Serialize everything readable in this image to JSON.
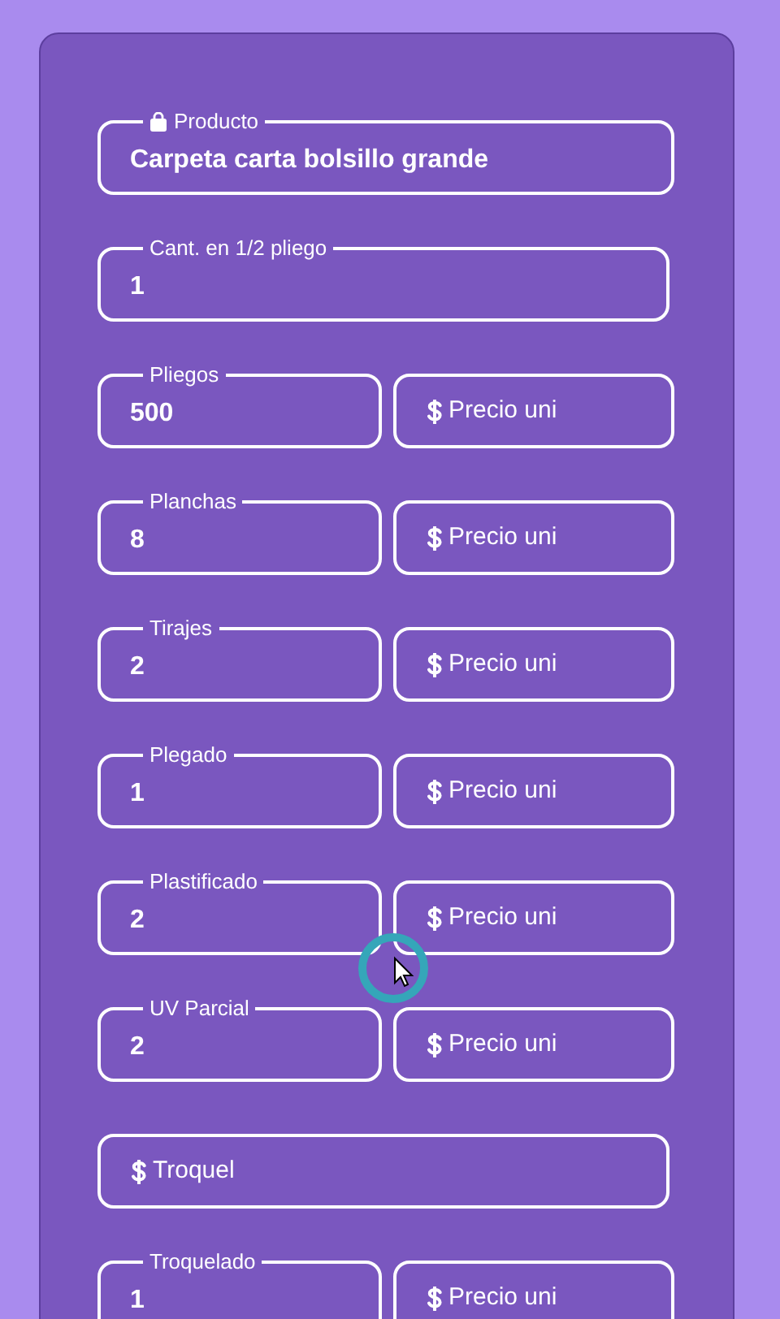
{
  "rows": [
    {
      "kind": "product",
      "label": "Producto",
      "value": "Carpeta carta bolsillo grande"
    },
    {
      "kind": "full",
      "label": "Cant. en 1/2 pliego",
      "value": "1"
    },
    {
      "kind": "pair",
      "label": "Pliegos",
      "value": "500",
      "price_placeholder": "Precio uni"
    },
    {
      "kind": "pair",
      "label": "Planchas",
      "value": "8",
      "price_placeholder": "Precio uni"
    },
    {
      "kind": "pair",
      "label": "Tirajes",
      "value": "2",
      "price_placeholder": "Precio uni"
    },
    {
      "kind": "pair",
      "label": "Plegado",
      "value": "1",
      "price_placeholder": "Precio uni"
    },
    {
      "kind": "pair",
      "label": "Plastificado",
      "value": "2",
      "price_placeholder": "Precio uni"
    },
    {
      "kind": "pair",
      "label": "UV Parcial",
      "value": "2",
      "price_placeholder": "Precio uni"
    },
    {
      "kind": "price",
      "placeholder": "Troquel"
    },
    {
      "kind": "pair",
      "label": "Troquelado",
      "value": "1",
      "price_placeholder": "Precio uni"
    }
  ]
}
